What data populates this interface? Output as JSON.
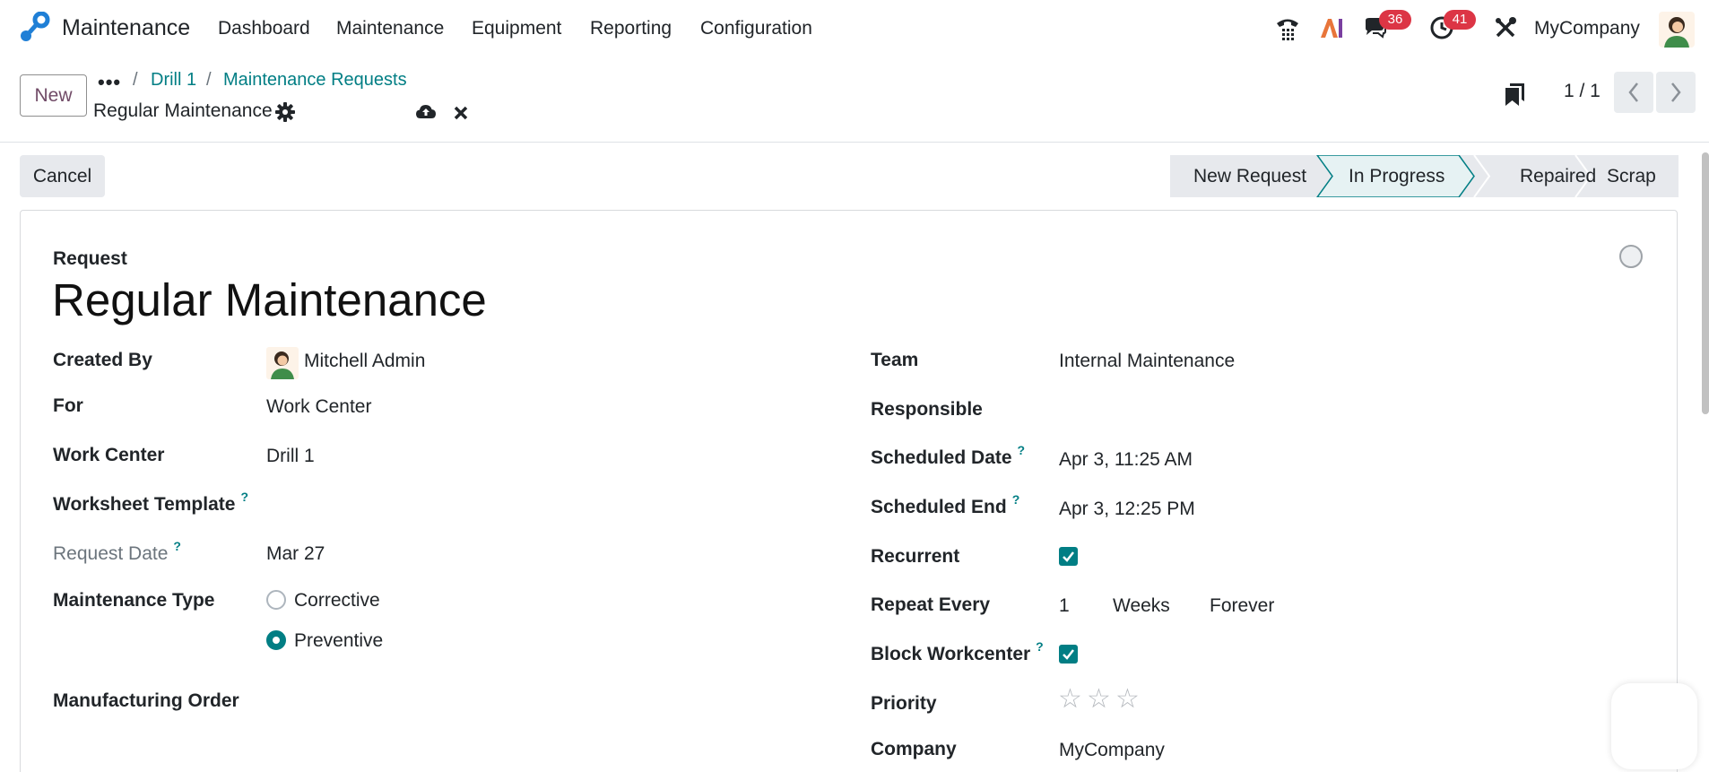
{
  "navbar": {
    "app_name": "Maintenance",
    "menus": [
      "Dashboard",
      "Maintenance",
      "Equipment",
      "Reporting",
      "Configuration"
    ],
    "messages_count": "36",
    "activities_count": "41",
    "company": "MyCompany",
    "icons": [
      "phone-icon",
      "ai-icon",
      "chat-icon",
      "clock-icon",
      "tools-icon"
    ]
  },
  "control_panel": {
    "new_label": "New",
    "breadcrumbs": [
      "Drill 1",
      "Maintenance Requests"
    ],
    "record_name": "Regular Maintenance",
    "pager": "1 / 1"
  },
  "statusbar": {
    "cancel_label": "Cancel",
    "stages": [
      "New Request",
      "In Progress",
      "Repaired",
      "Scrap"
    ],
    "active_stage": "In Progress"
  },
  "form": {
    "overline": "Request",
    "title": "Regular Maintenance",
    "left": {
      "created_by": {
        "label": "Created By",
        "value": "Mitchell Admin"
      },
      "for": {
        "label": "For",
        "value": "Work Center"
      },
      "work_center": {
        "label": "Work Center",
        "value": "Drill 1"
      },
      "worksheet_template": {
        "label": "Worksheet Template",
        "help": "?"
      },
      "request_date": {
        "label": "Request Date",
        "help": "?",
        "value": "Mar 27"
      },
      "maintenance_type": {
        "label": "Maintenance Type",
        "options": [
          "Corrective",
          "Preventive"
        ],
        "selected": "Preventive"
      },
      "manufacturing_order": {
        "label": "Manufacturing Order"
      }
    },
    "right": {
      "team": {
        "label": "Team",
        "value": "Internal Maintenance"
      },
      "responsible": {
        "label": "Responsible"
      },
      "scheduled_date": {
        "label": "Scheduled Date",
        "help": "?",
        "value": "Apr 3, 11:25 AM"
      },
      "scheduled_end": {
        "label": "Scheduled End",
        "help": "?",
        "value": "Apr 3, 12:25 PM"
      },
      "recurrent": {
        "label": "Recurrent",
        "checked": true
      },
      "repeat_every": {
        "label": "Repeat Every",
        "interval": "1",
        "unit": "Weeks",
        "until": "Forever"
      },
      "block_workcenter": {
        "label": "Block Workcenter",
        "help": "?",
        "checked": true
      },
      "priority": {
        "label": "Priority",
        "stars": 3,
        "filled": 0
      },
      "company": {
        "label": "Company",
        "value": "MyCompany"
      }
    }
  },
  "colors": {
    "primary": "#714B67",
    "teal": "#017e84",
    "danger": "#dc3545",
    "active_stage_bg": "#e6f2f3"
  }
}
